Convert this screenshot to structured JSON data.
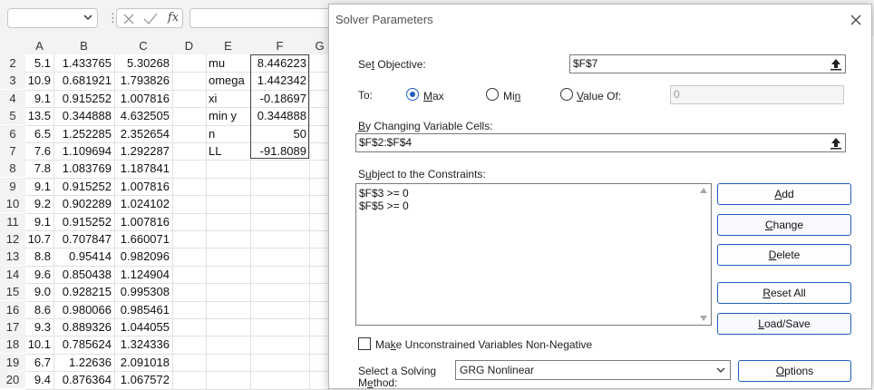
{
  "spreadsheet": {
    "formula_bar": {
      "fx_label": "fx",
      "separator": "⋮"
    },
    "column_headers": [
      "A",
      "B",
      "C",
      "D",
      "E",
      "F",
      "G"
    ],
    "rows": [
      {
        "row": "2",
        "a": "5.1",
        "b": "1.433765",
        "c": "5.30268",
        "e": "mu",
        "f": "8.446223"
      },
      {
        "row": "3",
        "a": "10.9",
        "b": "0.681921",
        "c": "1.793826",
        "e": "omega",
        "f": "1.442342"
      },
      {
        "row": "4",
        "a": "9.1",
        "b": "0.915252",
        "c": "1.007816",
        "e": "xi",
        "f": "-0.18697"
      },
      {
        "row": "5",
        "a": "13.5",
        "b": "0.344888",
        "c": "4.632505",
        "e": "min y",
        "f": "0.344888"
      },
      {
        "row": "6",
        "a": "6.5",
        "b": "1.252285",
        "c": "2.352654",
        "e": "n",
        "f": "50"
      },
      {
        "row": "7",
        "a": "7.6",
        "b": "1.109694",
        "c": "1.292287",
        "e": "LL",
        "f": "-91.8089"
      },
      {
        "row": "8",
        "a": "7.8",
        "b": "1.083769",
        "c": "1.187841",
        "e": "",
        "f": ""
      },
      {
        "row": "9",
        "a": "9.1",
        "b": "0.915252",
        "c": "1.007816",
        "e": "",
        "f": ""
      },
      {
        "row": "10",
        "a": "9.2",
        "b": "0.902289",
        "c": "1.024102",
        "e": "",
        "f": ""
      },
      {
        "row": "11",
        "a": "9.1",
        "b": "0.915252",
        "c": "1.007816",
        "e": "",
        "f": ""
      },
      {
        "row": "12",
        "a": "10.7",
        "b": "0.707847",
        "c": "1.660071",
        "e": "",
        "f": ""
      },
      {
        "row": "13",
        "a": "8.8",
        "b": "0.95414",
        "c": "0.982096",
        "e": "",
        "f": ""
      },
      {
        "row": "14",
        "a": "9.6",
        "b": "0.850438",
        "c": "1.124904",
        "e": "",
        "f": ""
      },
      {
        "row": "15",
        "a": "9.0",
        "b": "0.928215",
        "c": "0.995308",
        "e": "",
        "f": ""
      },
      {
        "row": "16",
        "a": "8.6",
        "b": "0.980066",
        "c": "0.985461",
        "e": "",
        "f": ""
      },
      {
        "row": "17",
        "a": "9.3",
        "b": "0.889326",
        "c": "1.044055",
        "e": "",
        "f": ""
      },
      {
        "row": "18",
        "a": "10.1",
        "b": "0.785624",
        "c": "1.324336",
        "e": "",
        "f": ""
      },
      {
        "row": "19",
        "a": "6.7",
        "b": "1.22636",
        "c": "2.091018",
        "e": "",
        "f": ""
      },
      {
        "row": "20",
        "a": "9.4",
        "b": "0.876364",
        "c": "1.067572",
        "e": "",
        "f": ""
      }
    ]
  },
  "dialog": {
    "title": "Solver Parameters",
    "set_objective": {
      "label_pre": "Se",
      "label_u": "t",
      "label_post": " Objective:",
      "value": "$F$7"
    },
    "to": {
      "label": "To:",
      "max": {
        "pre": "",
        "u": "M",
        "post": "ax"
      },
      "min": {
        "pre": "Mi",
        "u": "n",
        "post": ""
      },
      "value_of": {
        "pre": "",
        "u": "V",
        "post": "alue Of:"
      },
      "value_of_input": "0",
      "selected": "max"
    },
    "changing_cells": {
      "label_pre": "",
      "label_u": "B",
      "label_post": "y Changing Variable Cells:",
      "value": "$F$2:$F$4"
    },
    "constraints": {
      "label_pre": "S",
      "label_u": "u",
      "label_post": "bject to the Constraints:",
      "items": [
        "$F$3 >= 0",
        "$F$5 >= 0"
      ]
    },
    "buttons": {
      "add": {
        "pre": "",
        "u": "A",
        "post": "dd"
      },
      "change": {
        "pre": "",
        "u": "C",
        "post": "hange"
      },
      "delete": {
        "pre": "",
        "u": "D",
        "post": "elete"
      },
      "reset_all": {
        "pre": "",
        "u": "R",
        "post": "eset All"
      },
      "load_save": {
        "pre": "",
        "u": "L",
        "post": "oad/Save"
      },
      "options": {
        "pre": "",
        "u": "O",
        "post": "ptions"
      }
    },
    "nonneg": {
      "pre": "Ma",
      "u": "k",
      "post": "e Unconstrained Variables Non-Negative",
      "checked": false
    },
    "method": {
      "label_line1": "Select a Solving",
      "label_line2_pre": "M",
      "label_line2_u": "e",
      "label_line2_post": "thod:",
      "value": "GRG Nonlinear"
    }
  }
}
